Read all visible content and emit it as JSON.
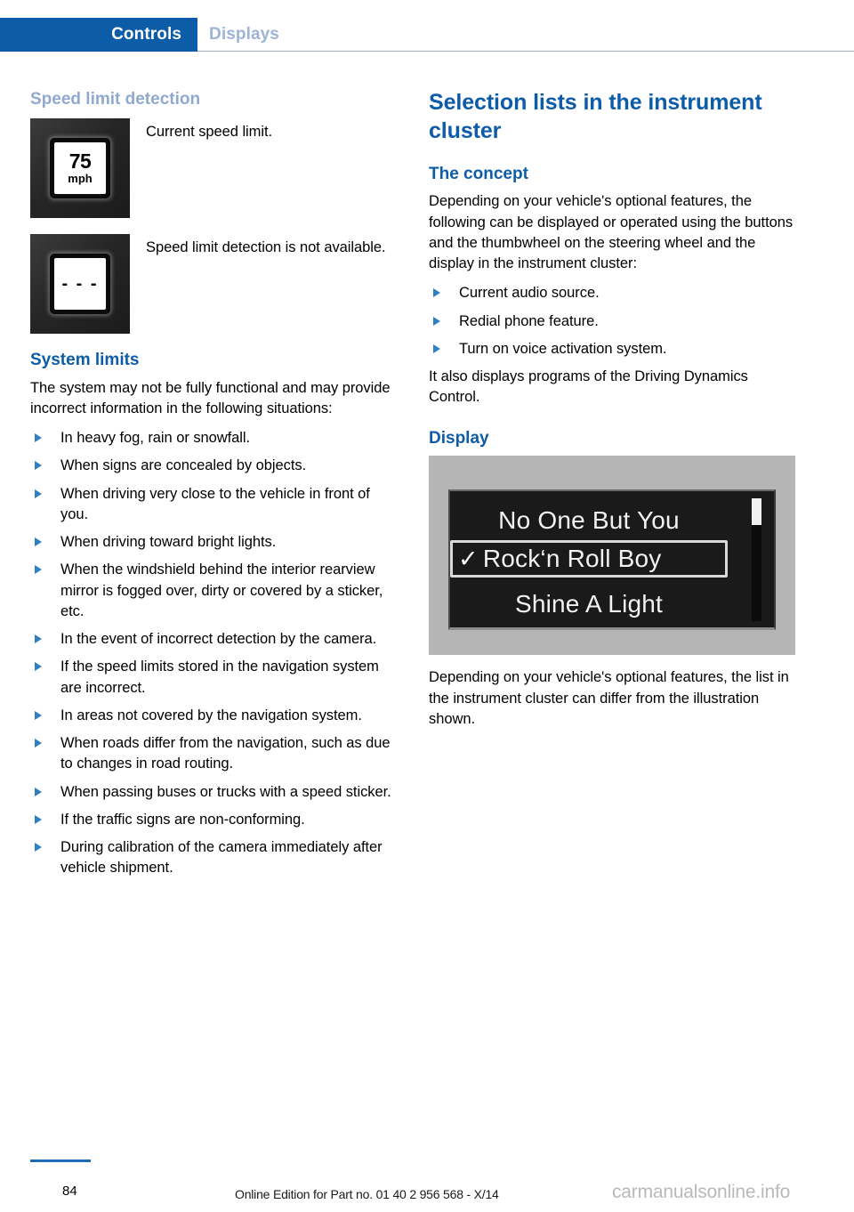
{
  "header": {
    "active_tab": "Controls",
    "inactive_tab": "Displays",
    "accent_color": "#0d5ca8",
    "muted_accent_color": "#9db4d8"
  },
  "left_column": {
    "continued_heading": "Speed limit detection",
    "figures": [
      {
        "icon": "speed-limit-sign-75-mph",
        "sign_value": "75",
        "sign_unit": "mph",
        "caption": "Current speed limit."
      },
      {
        "icon": "speed-limit-sign-unavailable",
        "sign_value": "- - -",
        "sign_unit": "",
        "caption": "Speed limit detection is not available."
      }
    ],
    "section": {
      "heading": "System limits",
      "intro": "The system may not be fully functional and may provide incorrect information in the following situations:",
      "bullets": [
        "In heavy fog, rain or snowfall.",
        "When signs are concealed by objects.",
        "When driving very close to the vehicle in front of you.",
        "When driving toward bright lights.",
        "When the windshield behind the interior rearview mirror is fogged over, dirty or covered by a sticker, etc.",
        "In the event of incorrect detection by the camera.",
        "If the speed limits stored in the navigation system are incorrect.",
        "In areas not covered by the navigation system.",
        "When roads differ from the navigation, such as due to changes in road routing.",
        "When passing buses or trucks with a speed sticker.",
        "If the traffic signs are non-conforming.",
        "During calibration of the camera immediately after vehicle shipment."
      ]
    }
  },
  "right_column": {
    "title": "Selection lists in the instrument cluster",
    "concept": {
      "heading": "The concept",
      "intro": "Depending on your vehicle's optional features, the following can be displayed or operated using the buttons and the thumbwheel on the steering wheel and the display in the instrument cluster:",
      "bullets": [
        "Current audio source.",
        "Redial phone feature.",
        "Turn on voice activation system."
      ],
      "outro": "It also displays programs of the Driving Dynamics Control."
    },
    "display": {
      "heading": "Display",
      "cluster": {
        "items": [
          {
            "label": "No One But You",
            "selected": false,
            "highlighted": false
          },
          {
            "label": "Rock‘n Roll Boy",
            "selected": true,
            "highlighted": true
          },
          {
            "label": "Shine A Light",
            "selected": false,
            "highlighted": false
          }
        ],
        "check_glyph": "✓"
      },
      "note": "Depending on your vehicle's optional features, the list in the instrument cluster can differ from the illustration shown."
    }
  },
  "footer": {
    "page_number": "84",
    "edition_note": "Online Edition for Part no. 01 40 2 956 568 - X/14",
    "watermark": "carmanualsonline.info"
  }
}
